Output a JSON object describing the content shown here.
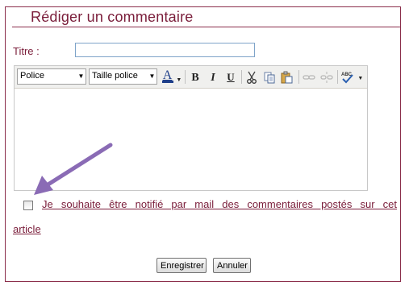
{
  "form": {
    "heading": "Rédiger un commentaire",
    "title_label": "Titre :",
    "title_value": "",
    "toolbar": {
      "font_select": "Police",
      "size_select": "Taille police",
      "icons": [
        "font-color-icon",
        "bold-icon",
        "italic-icon",
        "underline-icon",
        "cut-icon",
        "copy-icon",
        "paste-icon",
        "link-icon",
        "unlink-icon",
        "spellcheck-icon"
      ],
      "bold_glyph": "B",
      "italic_glyph": "I",
      "underline_glyph": "U",
      "font_color_glyph": "A"
    },
    "editor_content": "",
    "notify_label_line1": "Je souhaite être notifié par mail des commentaires postés sur cet",
    "notify_label_line2": "article",
    "notify_checked": false,
    "save_button": "Enregistrer",
    "cancel_button": "Annuler"
  },
  "colors": {
    "accent": "#7a1d3a",
    "annotation_arrow": "#8a6bb5"
  }
}
